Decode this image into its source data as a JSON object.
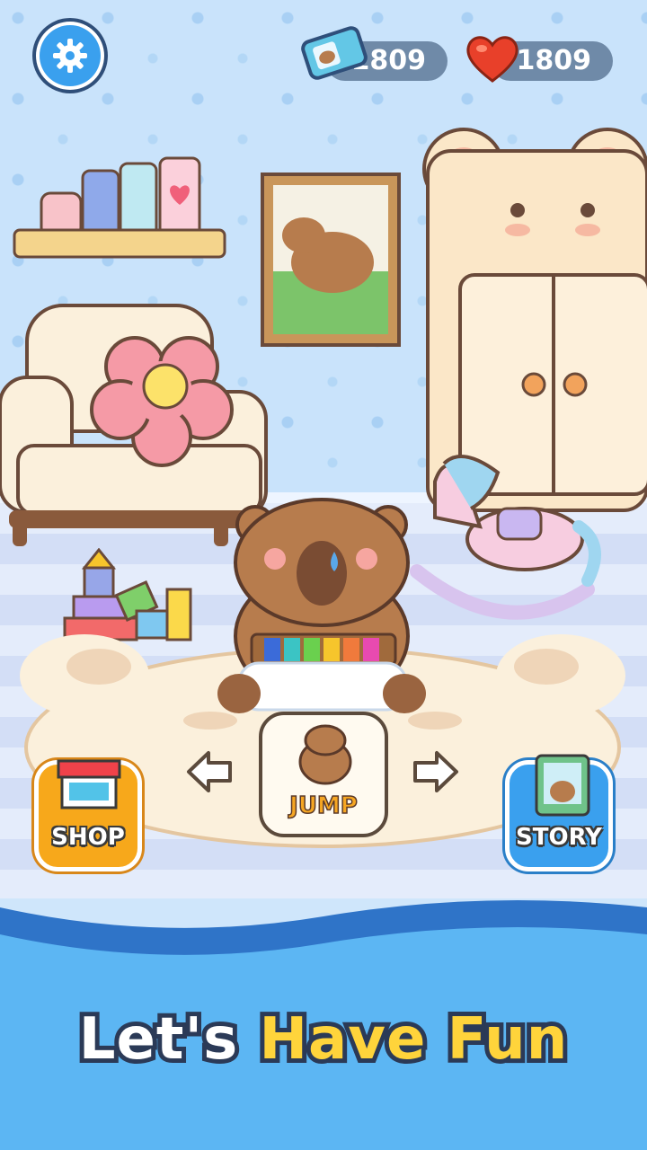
{
  "hud": {
    "tickets": {
      "value": "1809",
      "icon": "ticket-icon"
    },
    "hearts": {
      "value": "1809",
      "icon": "heart-icon"
    },
    "settings_icon": "gear-icon"
  },
  "actions": {
    "current_label": "JUMP",
    "prev_icon": "arrow-left-icon",
    "next_icon": "arrow-right-icon"
  },
  "menu": {
    "shop_label": "SHOP",
    "story_label": "STORY"
  },
  "banner": {
    "part1": "Let's",
    "part2": "Have Fun"
  },
  "colors": {
    "wall": "#c9e3fb",
    "sea": "#5cb6f3",
    "shop": "#f7a81b",
    "story": "#3aa0ee",
    "banner_white": "#ffffff",
    "banner_yellow": "#ffd43b",
    "outline": "#2b3a57"
  }
}
